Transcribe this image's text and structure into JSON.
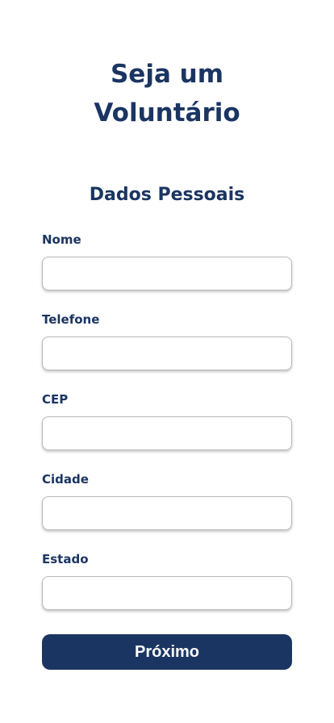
{
  "header": {
    "title_line1": "Seja um",
    "title_line2": "Voluntário"
  },
  "form": {
    "section_title": "Dados Pessoais",
    "fields": [
      {
        "label": "Nome",
        "value": "",
        "placeholder": ""
      },
      {
        "label": "Telefone",
        "value": "",
        "placeholder": ""
      },
      {
        "label": "CEP",
        "value": "",
        "placeholder": ""
      },
      {
        "label": "Cidade",
        "value": "",
        "placeholder": ""
      },
      {
        "label": "Estado",
        "value": "",
        "placeholder": ""
      }
    ],
    "next_label": "Próximo"
  },
  "colors": {
    "primary": "#1b3562",
    "background": "#ffffff",
    "input_border": "#b9b9b9"
  }
}
